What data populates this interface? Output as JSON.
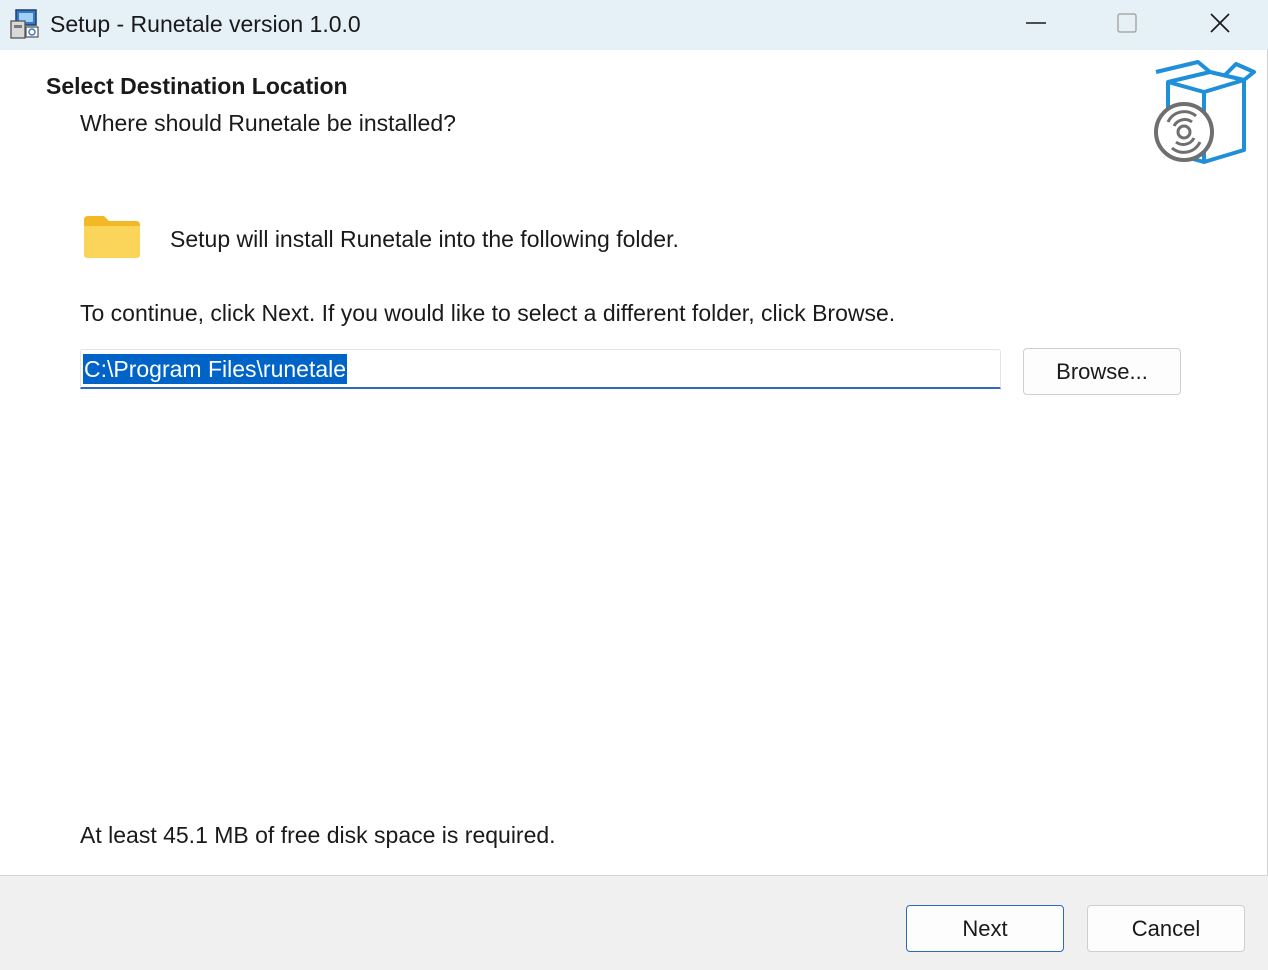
{
  "window": {
    "title": "Setup - Runetale version 1.0.0",
    "icons": {
      "app": "installer-icon",
      "minimize": "minimize-icon",
      "maximize": "maximize-icon",
      "close": "close-icon"
    }
  },
  "header": {
    "title": "Select Destination Location",
    "subtitle": "Where should Runetale be installed?",
    "icon": "software-box-icon"
  },
  "body": {
    "folder_icon": "folder-icon",
    "install_info": "Setup will install Runetale into the following folder.",
    "continue_text": "To continue, click Next. If you would like to select a different folder, click Browse.",
    "path_value": "C:\\Program Files\\runetale",
    "browse_label": "Browse...",
    "disk_space": "At least 45.1 MB of free disk space is required."
  },
  "footer": {
    "next_label": "Next",
    "cancel_label": "Cancel"
  },
  "colors": {
    "titlebar_bg": "#e6f0f7",
    "accent": "#2d6cb5",
    "selection": "#0063c7",
    "box_icon": "#1e8fd8",
    "folder": "#f7c948"
  }
}
